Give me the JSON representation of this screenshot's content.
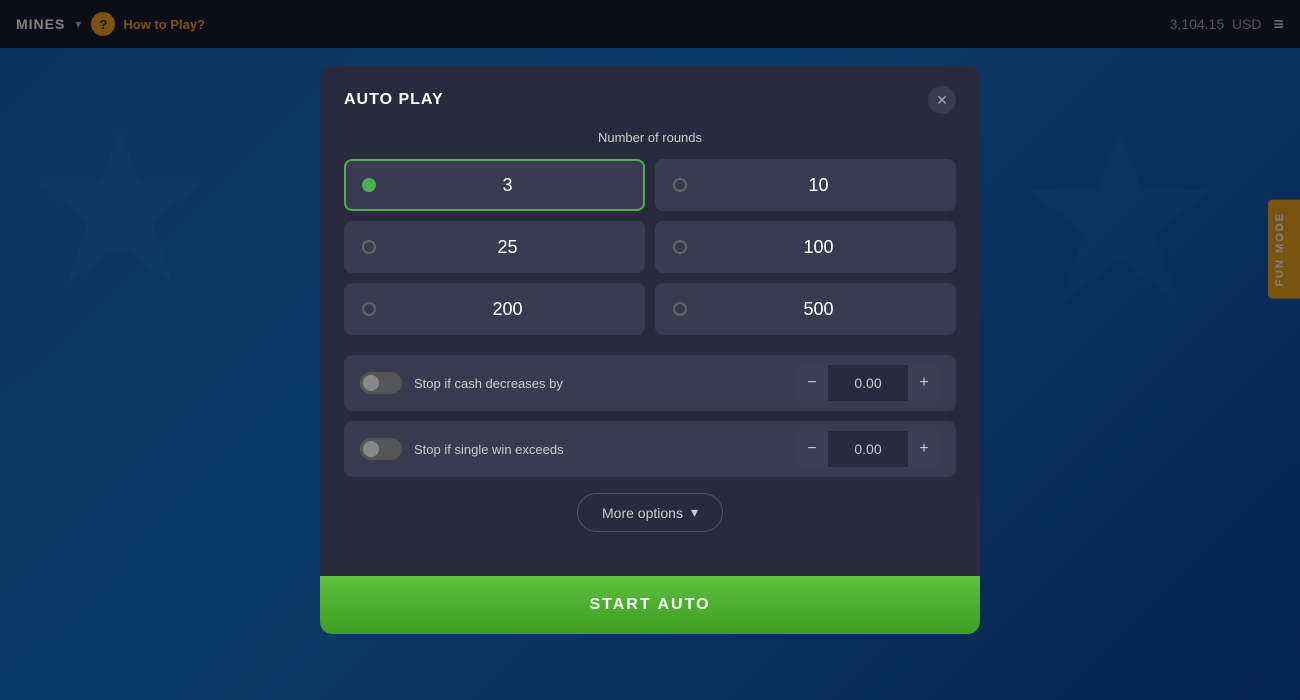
{
  "topbar": {
    "game_title": "MINES",
    "chevron": "▾",
    "help_label": "?",
    "how_to_play": "How to Play?",
    "balance": "3,104.15",
    "currency": "USD",
    "menu_icon": "≡"
  },
  "fun_mode": {
    "label": "FUN MODE"
  },
  "modal": {
    "title": "AUTO PLAY",
    "close_label": "✕",
    "rounds_label": "Number of rounds",
    "rounds": [
      {
        "value": "3",
        "selected": true
      },
      {
        "value": "10",
        "selected": false
      },
      {
        "value": "25",
        "selected": false
      },
      {
        "value": "100",
        "selected": false
      },
      {
        "value": "200",
        "selected": false
      },
      {
        "value": "500",
        "selected": false
      }
    ],
    "stop_cash": {
      "label": "Stop if cash decreases by",
      "value": "0.00",
      "minus": "−",
      "plus": "+"
    },
    "stop_win": {
      "label": "Stop if single win exceeds",
      "value": "0.00",
      "minus": "−",
      "plus": "+"
    },
    "more_options": "More options",
    "chevron_down": "▾",
    "start_auto": "START AUTO"
  }
}
